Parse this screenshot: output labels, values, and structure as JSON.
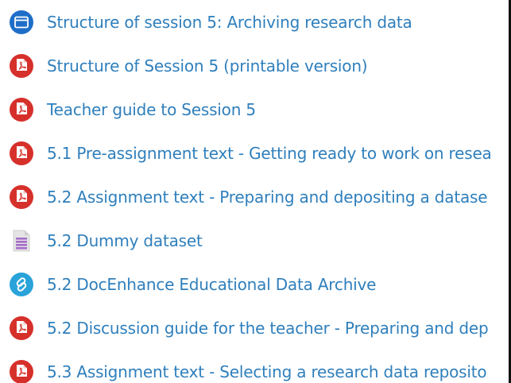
{
  "colors": {
    "link": "#2f7fbc",
    "pdf_red": "#d6302b",
    "page_blue": "#1e6ec8",
    "url_blue": "#29a3d9",
    "file_purple": "#a66cc9"
  },
  "activities": [
    {
      "icon": "page-icon",
      "label": "Structure of session 5: Archiving research data"
    },
    {
      "icon": "pdf-icon",
      "label": "Structure of Session 5 (printable version)"
    },
    {
      "icon": "pdf-icon",
      "label": "Teacher guide to Session 5"
    },
    {
      "icon": "pdf-icon",
      "label": "5.1 Pre-assignment text - Getting ready to work on resea"
    },
    {
      "icon": "pdf-icon",
      "label": "5.2 Assignment text - Preparing and depositing a datase"
    },
    {
      "icon": "file-icon",
      "label": "5.2 Dummy dataset"
    },
    {
      "icon": "url-icon",
      "label": "5.2 DocEnhance Educational Data Archive"
    },
    {
      "icon": "pdf-icon",
      "label": "5.2 Discussion guide for the teacher - Preparing and dep"
    },
    {
      "icon": "pdf-icon",
      "label": "5.3 Assignment text - Selecting a research data reposito"
    }
  ]
}
